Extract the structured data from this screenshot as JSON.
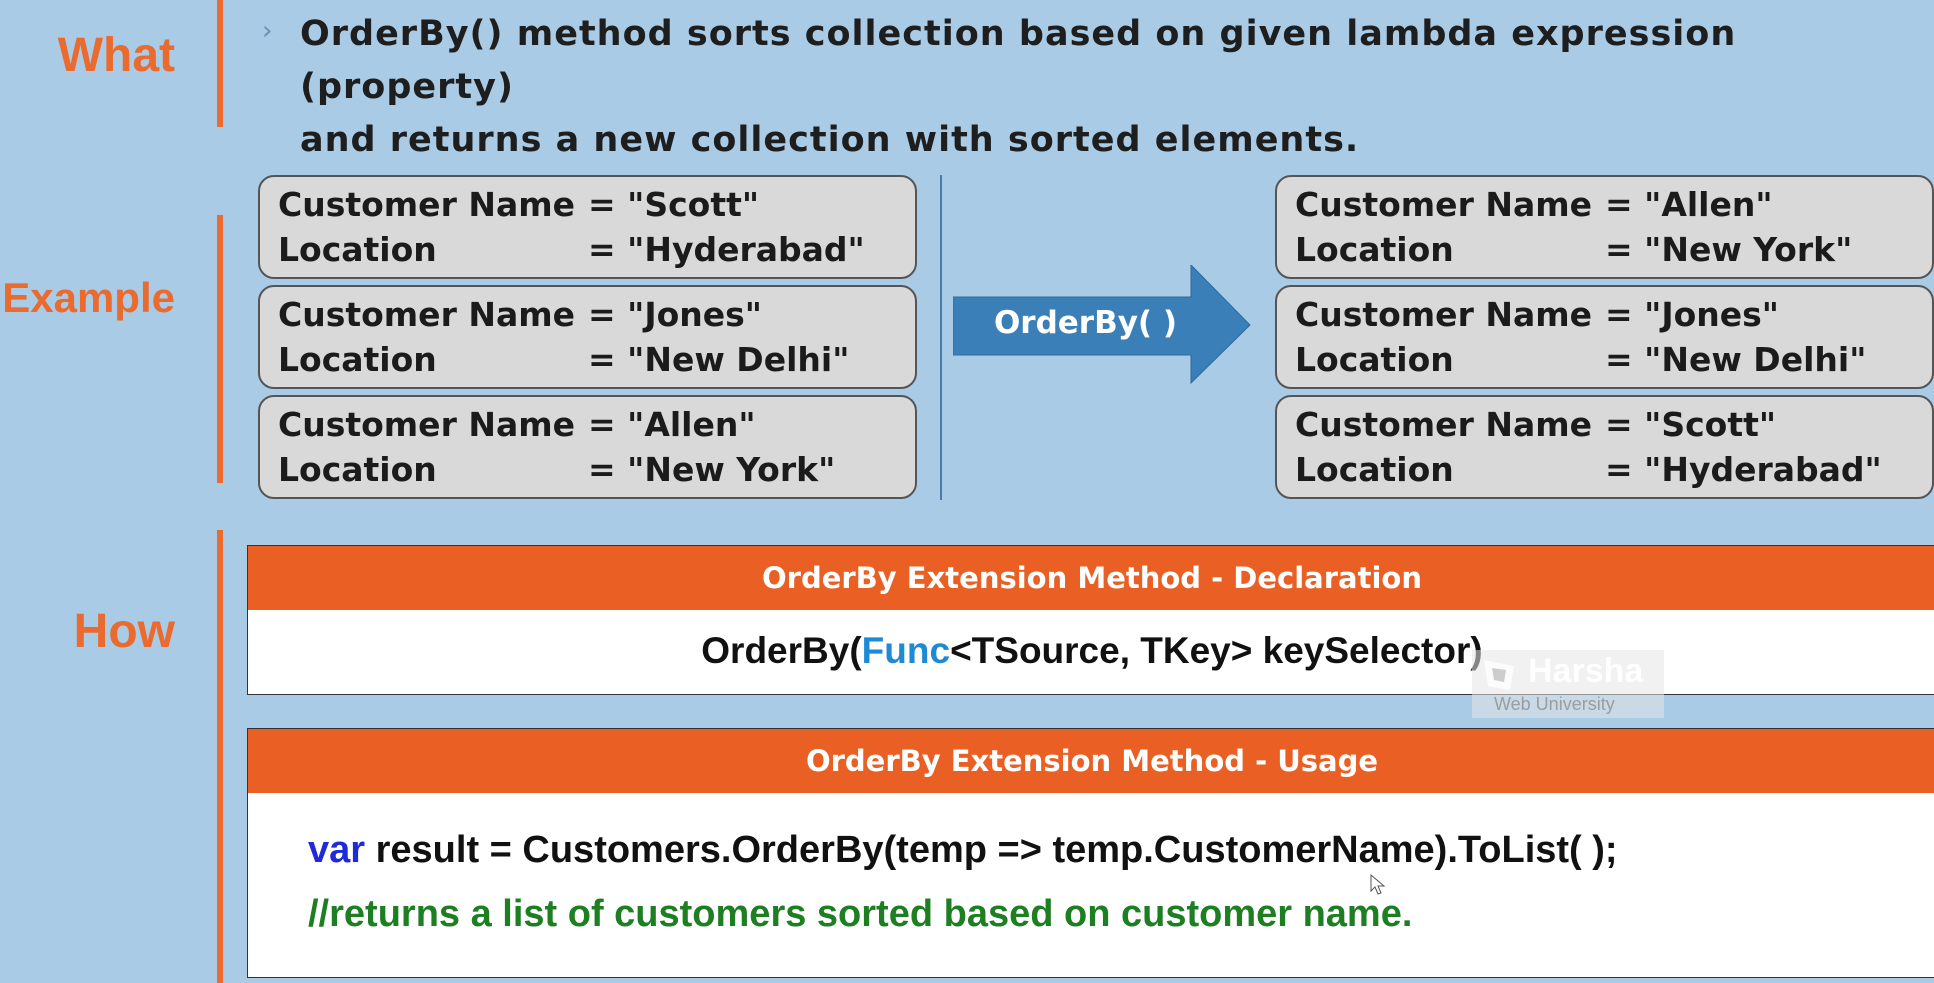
{
  "sections": {
    "what": "What",
    "example": "Example",
    "how": "How"
  },
  "what_text": {
    "line1": "OrderBy() method sorts collection based on given lambda expression (property)",
    "line2": "and returns a new collection with sorted elements."
  },
  "field_labels": {
    "name": "Customer Name",
    "location": "Location"
  },
  "before": [
    {
      "name": "= \"Scott\"",
      "location": "= \"Hyderabad\""
    },
    {
      "name": "= \"Jones\"",
      "location": "= \"New Delhi\""
    },
    {
      "name": "= \"Allen\"",
      "location": "= \"New York\""
    }
  ],
  "after": [
    {
      "name": "= \"Allen\"",
      "location": "= \"New York\""
    },
    {
      "name": "= \"Jones\"",
      "location": "= \"New Delhi\""
    },
    {
      "name": "= \"Scott\"",
      "location": "= \"Hyderabad\""
    }
  ],
  "arrow_label": "OrderBy( )",
  "declaration": {
    "title": "OrderBy Extension Method - Declaration",
    "prefix": "OrderBy(",
    "func": "Func",
    "suffix": "<TSource, TKey>  keySelector)"
  },
  "usage": {
    "title": "OrderBy Extension Method - Usage",
    "keyword": "var",
    "code": " result = Customers.OrderBy(temp => temp.CustomerName).ToList( );",
    "comment": "//returns a list of customers sorted based on customer name."
  },
  "watermark": {
    "title": "Harsha",
    "subtitle": "Web University"
  },
  "colors": {
    "accent": "#eb6a2d",
    "background": "#a9cbe6",
    "arrow": "#3a7fb8",
    "keyword": "#1f2ad8",
    "func": "#1e8ad6",
    "comment": "#1d7f22"
  }
}
